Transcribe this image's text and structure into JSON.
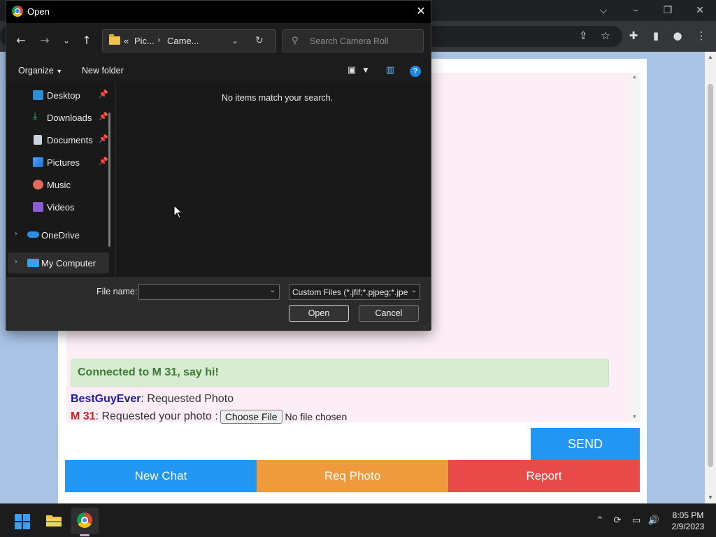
{
  "dialog": {
    "title": "Open",
    "path_overflow": "«",
    "path_segments": [
      "Pic...",
      "Came..."
    ],
    "search_placeholder": "Search Camera Roll",
    "organize_label": "Organize",
    "new_folder_label": "New folder",
    "empty_message": "No items match your search.",
    "nav_items": [
      {
        "label": "Desktop",
        "icon": "desktop-icon",
        "pinned": true
      },
      {
        "label": "Downloads",
        "icon": "download-icon",
        "pinned": true
      },
      {
        "label": "Documents",
        "icon": "document-icon",
        "pinned": true
      },
      {
        "label": "Pictures",
        "icon": "pictures-icon",
        "pinned": true
      },
      {
        "label": "Music",
        "icon": "music-icon",
        "pinned": false
      },
      {
        "label": "Videos",
        "icon": "video-icon",
        "pinned": false
      },
      {
        "label": "OneDrive",
        "icon": "cloud-icon",
        "expandable": true
      },
      {
        "label": "My Computer",
        "icon": "computer-icon",
        "expandable": true,
        "selected": true
      }
    ],
    "file_name_label": "File name:",
    "file_name_value": "",
    "file_type_value": "Custom Files (*.jfif;*.pjpeg;*.jpeg;*.pjp;*.jpg;*.png)",
    "open_label": "Open",
    "cancel_label": "Cancel"
  },
  "chat": {
    "status": "Connected to M 31, say hi!",
    "messages": [
      {
        "sender": "BestGuyEver",
        "text": ": Requested Photo"
      },
      {
        "sender": "M 31",
        "text": ": Requested your photo :"
      }
    ],
    "choose_file_label": "Choose File",
    "no_file_label": "No file chosen",
    "send_label": "SEND",
    "new_chat_label": "New Chat",
    "req_photo_label": "Req Photo",
    "report_label": "Report"
  },
  "taskbar": {
    "time": "8:05 PM",
    "date": "2/9/2023"
  },
  "colors": {
    "send": "#2196f3",
    "new_chat": "#2196f3",
    "req_photo": "#f09a3e",
    "report": "#e84949",
    "status_bg": "#d7ecd0",
    "status_text": "#3c7a38",
    "chat_bg": "#fdeef6"
  }
}
